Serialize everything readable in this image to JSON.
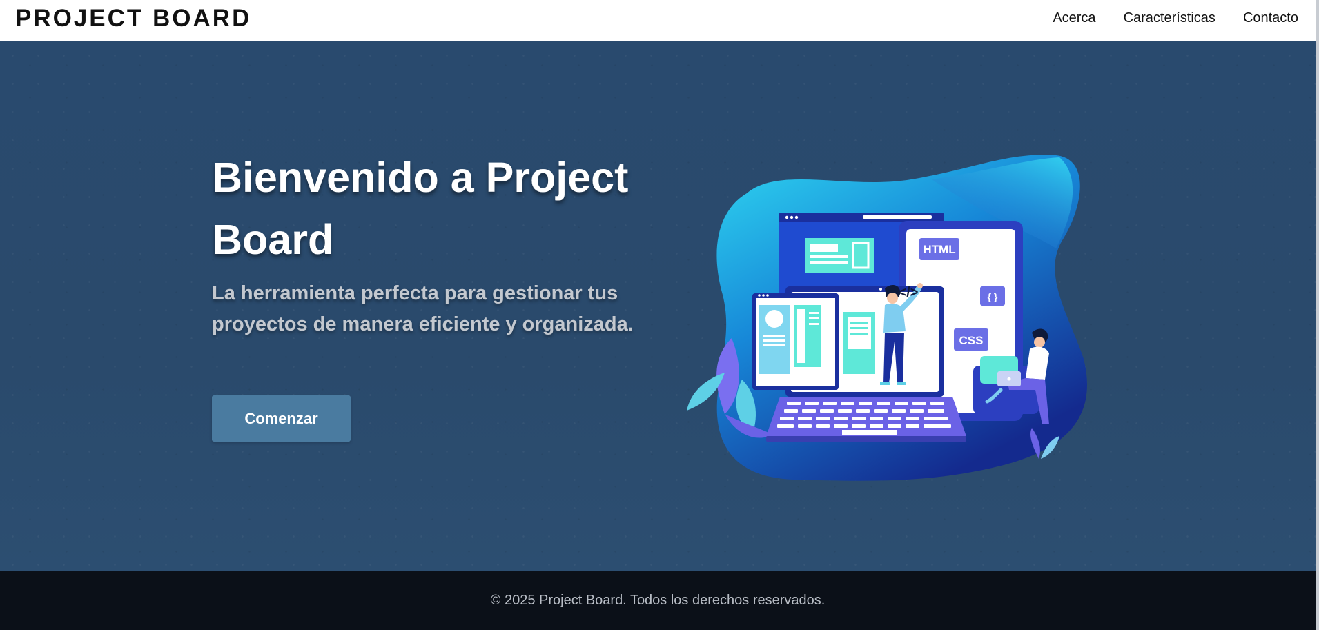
{
  "header": {
    "brand": "PROJECT BOARD",
    "nav": [
      {
        "label": "Acerca"
      },
      {
        "label": "Características"
      },
      {
        "label": "Contacto"
      }
    ]
  },
  "hero": {
    "title": "Bienvenido a Project Board",
    "subtitle": "La herramienta perfecta para gestionar tus proyectos de manera eficiente y organizada.",
    "cta_label": "Comenzar",
    "illustration": {
      "html_label": "HTML",
      "css_label": "CSS",
      "braces_label": "{ }",
      "code_label": "</>"
    }
  },
  "footer": {
    "text": "© 2025 Project Board. Todos los derechos reservados."
  },
  "colors": {
    "hero_bg": "#2b4a6d",
    "cta_bg": "#4a7ba0",
    "footer_bg": "#0b1018",
    "accent_cyan": "#2bd4ee",
    "accent_indigo": "#1a2f9e"
  }
}
